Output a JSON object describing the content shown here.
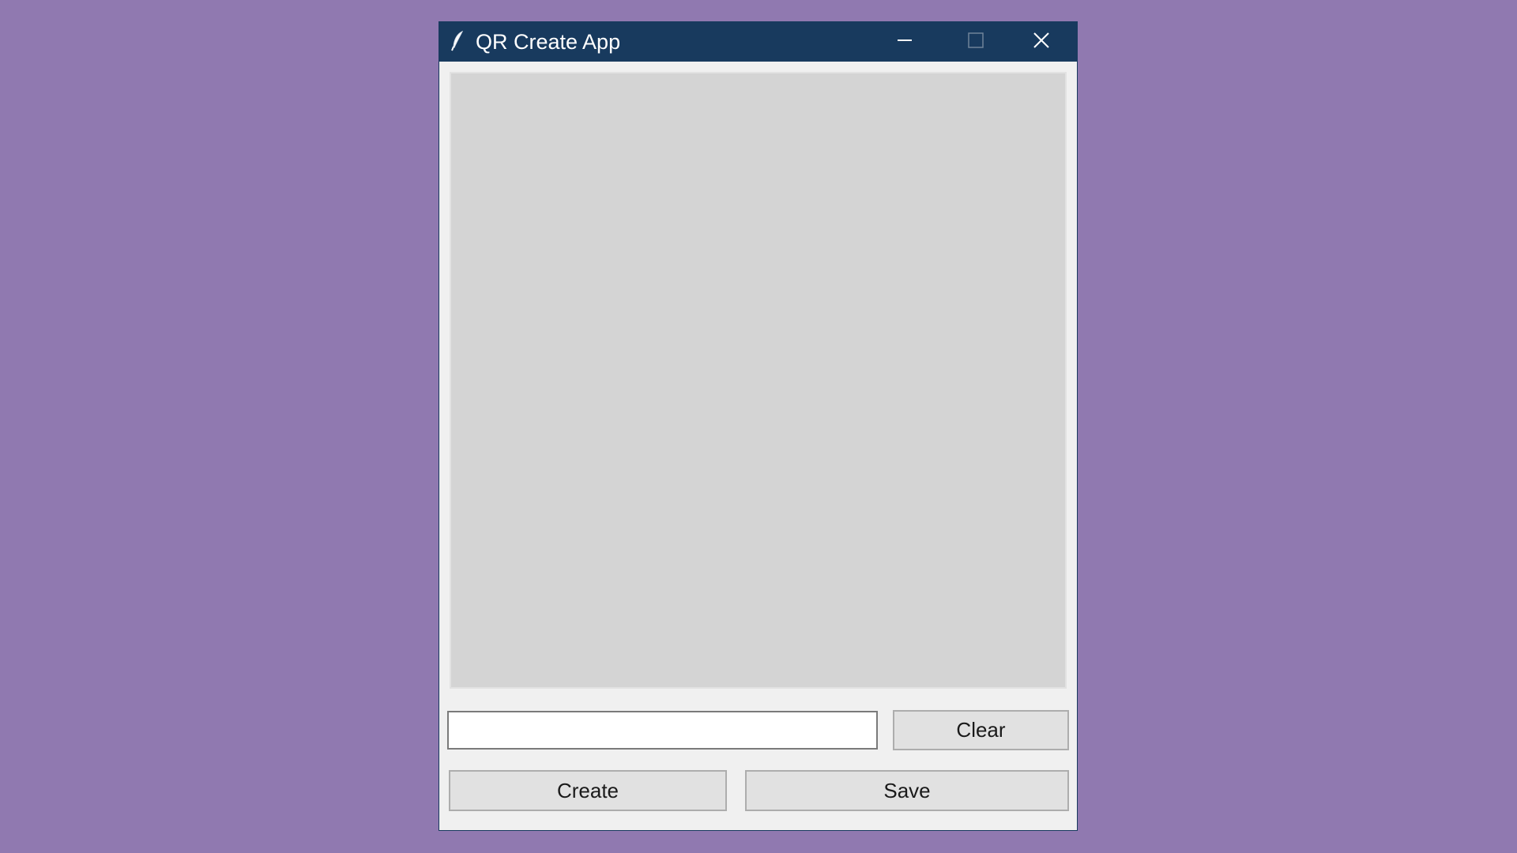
{
  "window": {
    "title": "QR Create App",
    "title_bar_color": "#183a5e",
    "icons": {
      "app": "feather-icon",
      "minimize": "minimize-icon",
      "maximize": "maximize-icon",
      "close": "close-icon"
    }
  },
  "canvas": {
    "background_color": "#d4d4d4"
  },
  "entry": {
    "value": "",
    "placeholder": ""
  },
  "buttons": {
    "clear_label": "Clear",
    "create_label": "Create",
    "save_label": "Save"
  },
  "desktop": {
    "background_color": "#9079b0"
  }
}
